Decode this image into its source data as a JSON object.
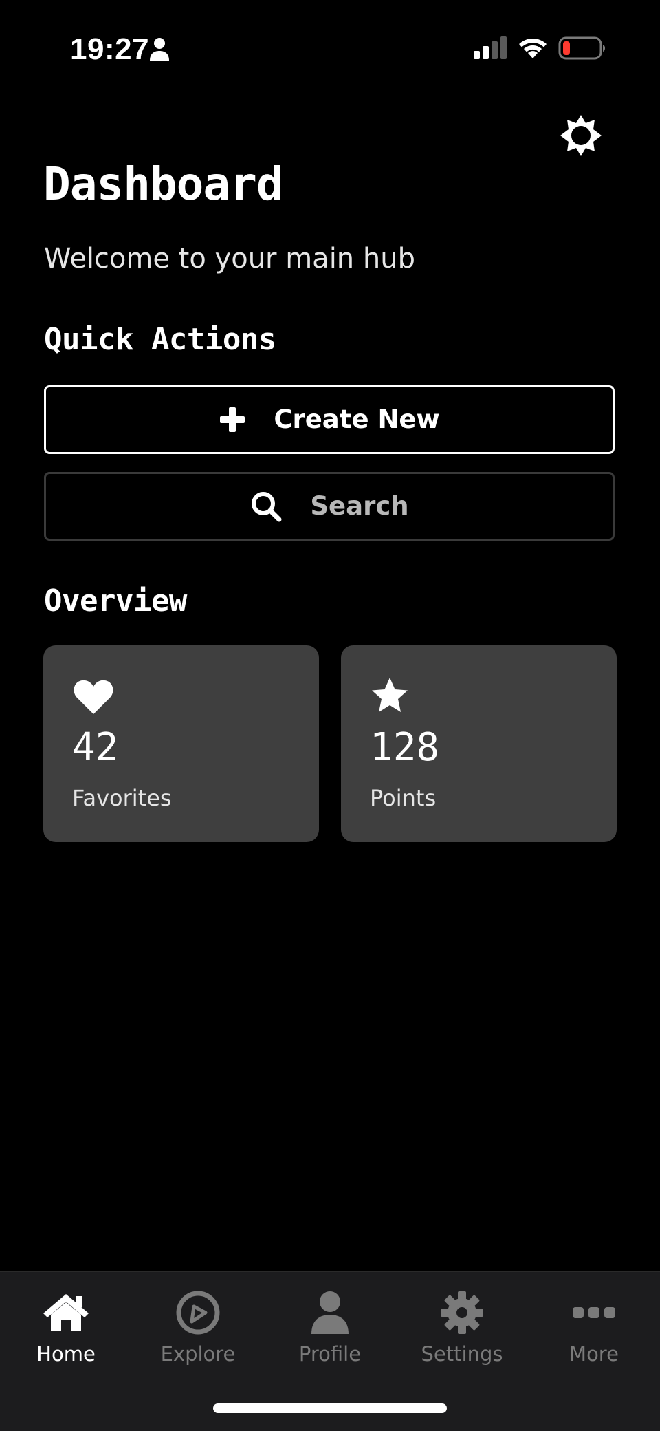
{
  "status_bar": {
    "time": "19:27",
    "icons": [
      "person-icon",
      "cellular-signal-icon",
      "wifi-icon",
      "battery-low-icon"
    ],
    "battery_color": "#ff3b30"
  },
  "header": {
    "title": "Dashboard",
    "subtitle": "Welcome to your main hub",
    "theme_toggle_icon": "sun-icon"
  },
  "quick_actions": {
    "heading": "Quick Actions",
    "create": {
      "label": "Create New",
      "icon": "plus-icon"
    },
    "search": {
      "label": "Search",
      "icon": "search-icon"
    }
  },
  "overview": {
    "heading": "Overview",
    "cards": [
      {
        "icon": "heart-icon",
        "value": "42",
        "label": "Favorites"
      },
      {
        "icon": "star-icon",
        "value": "128",
        "label": "Points"
      }
    ]
  },
  "tab_bar": {
    "active": "Home",
    "items": [
      {
        "label": "Home",
        "icon": "home-icon"
      },
      {
        "label": "Explore",
        "icon": "compass-icon"
      },
      {
        "label": "Profile",
        "icon": "person-icon"
      },
      {
        "label": "Settings",
        "icon": "gear-icon"
      },
      {
        "label": "More",
        "icon": "more-dots-icon"
      }
    ]
  },
  "colors": {
    "background": "#000000",
    "card": "#3f3f3f",
    "tab_bar": "#1c1c1e",
    "inactive_tab": "#7a7a7a",
    "search_border": "#3a3a3a"
  }
}
